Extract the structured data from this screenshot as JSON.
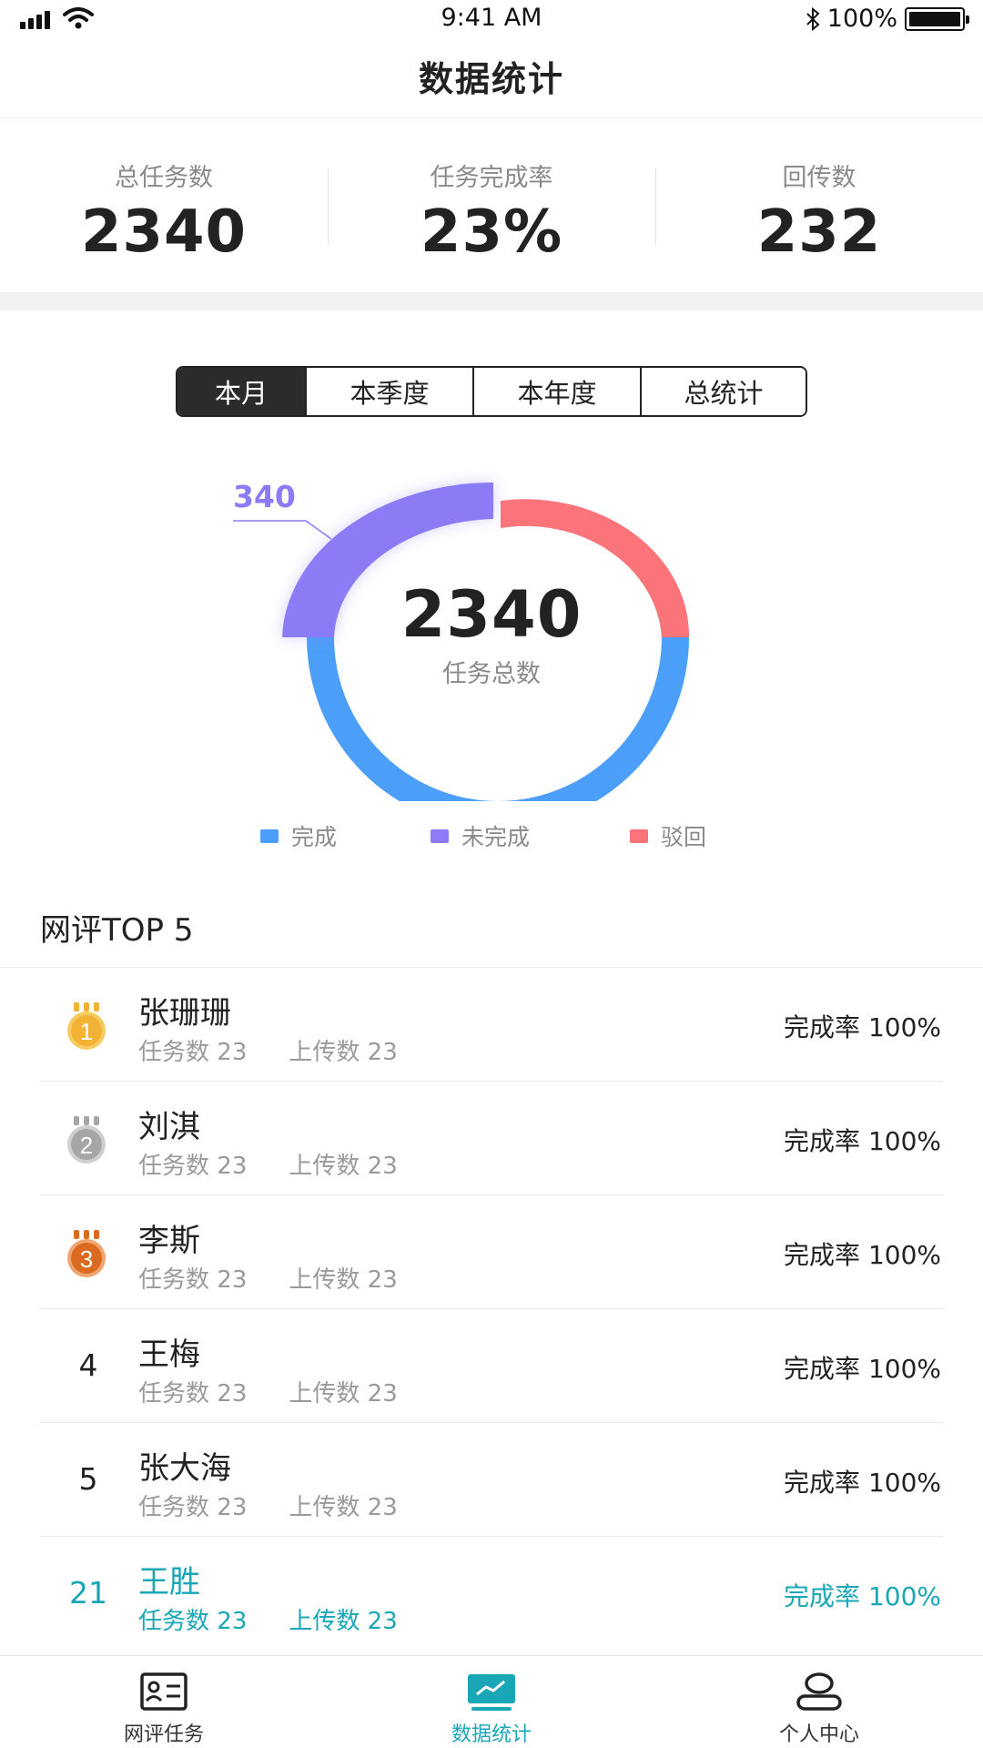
{
  "status_bar": {
    "time": "9:41 AM",
    "battery": "100%"
  },
  "header": {
    "title": "数据统计"
  },
  "summary": [
    {
      "label": "总任务数",
      "value": "2340"
    },
    {
      "label": "任务完成率",
      "value": "23%"
    },
    {
      "label": "回传数",
      "value": "232"
    }
  ],
  "period_tabs": [
    {
      "label": "本月",
      "active": true
    },
    {
      "label": "本季度",
      "active": false
    },
    {
      "label": "本年度",
      "active": false
    },
    {
      "label": "总统计",
      "active": false
    }
  ],
  "donut": {
    "center_value": "2340",
    "center_label": "任务总数",
    "callout_value": "340",
    "segments": [
      {
        "name": "完成",
        "share": 0.5,
        "color": "#4b9ff8"
      },
      {
        "name": "未完成",
        "share": 0.25,
        "color": "#8b7bf6"
      },
      {
        "name": "驳回",
        "share": 0.25,
        "color": "#fb7479"
      }
    ]
  },
  "legend": [
    {
      "label": "完成",
      "color": "#4b9ff8"
    },
    {
      "label": "未完成",
      "color": "#8b7bf6"
    },
    {
      "label": "驳回",
      "color": "#fb7479"
    }
  ],
  "top5": {
    "title": "网评TOP 5",
    "tasks_label": "任务数",
    "uploads_label": "上传数",
    "rate_label": "完成率",
    "rows": [
      {
        "rank": "1",
        "name": "张珊珊",
        "tasks": "23",
        "uploads": "23",
        "rate": "100%",
        "medal": "gold"
      },
      {
        "rank": "2",
        "name": "刘淇",
        "tasks": "23",
        "uploads": "23",
        "rate": "100%",
        "medal": "silver"
      },
      {
        "rank": "3",
        "name": "李斯",
        "tasks": "23",
        "uploads": "23",
        "rate": "100%",
        "medal": "bronze"
      },
      {
        "rank": "4",
        "name": "王梅",
        "tasks": "23",
        "uploads": "23",
        "rate": "100%",
        "medal": ""
      },
      {
        "rank": "5",
        "name": "张大海",
        "tasks": "23",
        "uploads": "23",
        "rate": "100%",
        "medal": ""
      },
      {
        "rank": "21",
        "name": "王胜",
        "tasks": "23",
        "uploads": "23",
        "rate": "100%",
        "medal": "",
        "is_me": true
      }
    ]
  },
  "tabbar": [
    {
      "label": "网评任务",
      "icon": "task-card-icon",
      "active": false
    },
    {
      "label": "数据统计",
      "icon": "chart-icon",
      "active": true
    },
    {
      "label": "个人中心",
      "icon": "user-icon",
      "active": false
    }
  ],
  "colors": {
    "accent": "#19a6b6",
    "dark": "#2b2b2b"
  }
}
